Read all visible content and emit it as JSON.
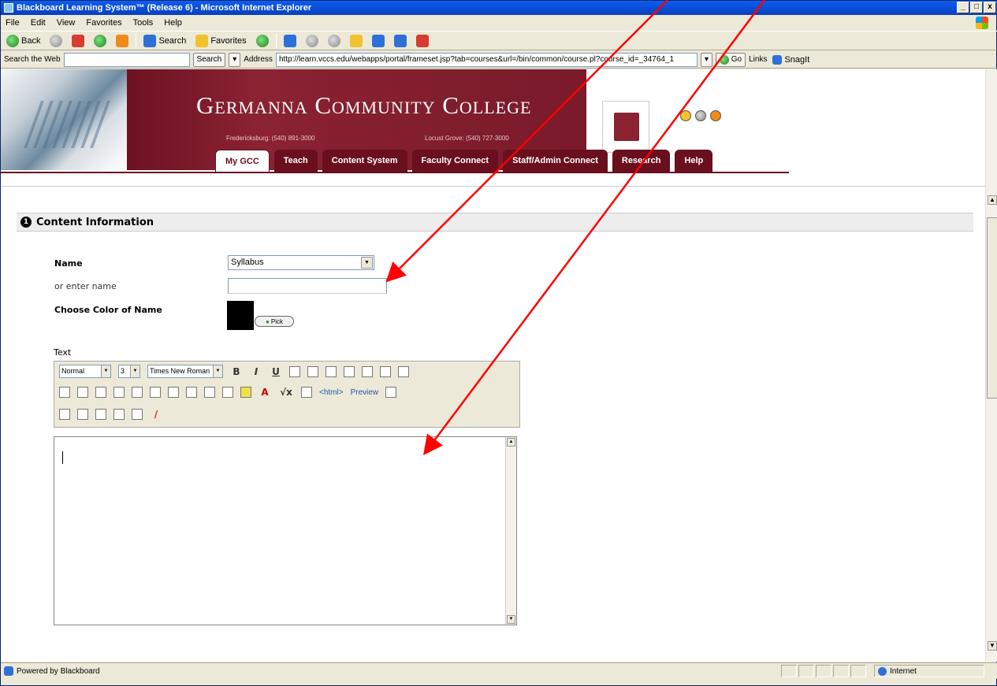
{
  "window": {
    "title": "Blackboard Learning System™ (Release 6) - Microsoft Internet Explorer",
    "min": "_",
    "max": "□",
    "close": "x"
  },
  "menu": [
    "File",
    "Edit",
    "View",
    "Favorites",
    "Tools",
    "Help"
  ],
  "toolbar": {
    "back": "Back",
    "search": "Search",
    "favorites": "Favorites"
  },
  "addressbar": {
    "search_web_label": "Search the Web",
    "search_btn": "Search",
    "address_label": "Address",
    "url": "http://learn.vccs.edu/webapps/portal/frameset.jsp?tab=courses&url=/bin/common/course.pl?course_id=_34764_1",
    "go": "Go",
    "links": "Links",
    "snagit": "SnagIt"
  },
  "banner": {
    "college": "Germanna Community College",
    "loc1": "Fredericksburg: (540) 891-3000",
    "loc2": "Locust Grove: (540) 727-3000",
    "tabs": [
      "My GCC",
      "Teach",
      "Content System",
      "Faculty Connect",
      "Staff/Admin Connect",
      "Research",
      "Help"
    ]
  },
  "section": {
    "number": "1",
    "title": "Content Information"
  },
  "form": {
    "name_label": "Name",
    "name_value": "Syllabus",
    "enter_name_label": "or enter name",
    "color_label": "Choose Color of Name",
    "pick_btn": "Pick",
    "text_label": "Text"
  },
  "editor": {
    "format": "Normal",
    "size": "3",
    "font": "Times New Roman",
    "buttons1": [
      "B",
      "I",
      "U"
    ],
    "html_btn": "<html>",
    "preview": "Preview"
  },
  "status": {
    "left": "Powered by Blackboard",
    "zone": "Internet"
  },
  "colors": {
    "maroon": "#6a0f1d",
    "arrow": "#ff0000"
  }
}
